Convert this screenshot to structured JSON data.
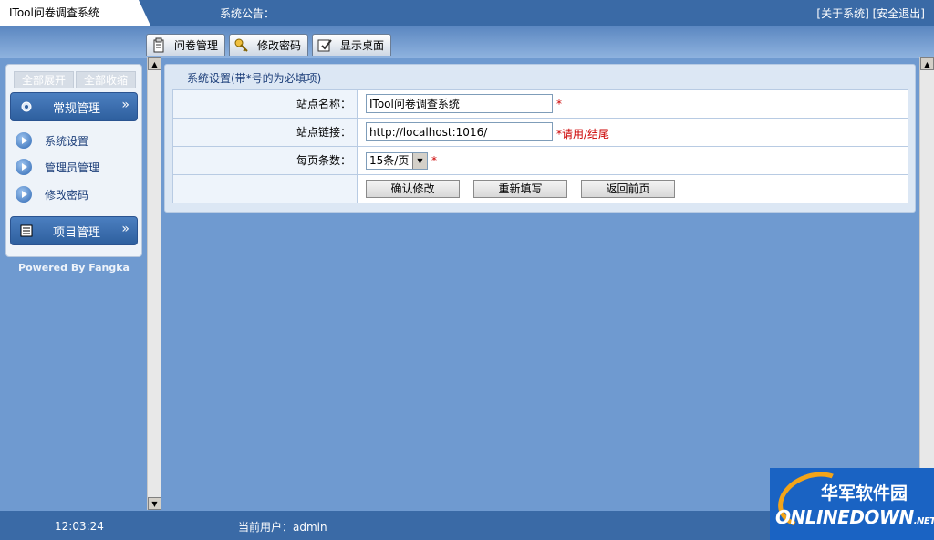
{
  "header": {
    "app_title": "ITool问卷调查系统",
    "notice_label": "系统公告：",
    "about_link": "[关于系统]",
    "logout_link": "[安全退出]"
  },
  "tabs": [
    {
      "label": "问卷管理",
      "icon": "clipboard-icon"
    },
    {
      "label": "修改密码",
      "icon": "key-icon"
    },
    {
      "label": "显示桌面",
      "icon": "desktop-icon"
    }
  ],
  "sidebar": {
    "expand_all": "全部展开",
    "collapse_all": "全部收缩",
    "groups": [
      {
        "label": "常规管理",
        "icon": "gear-icon",
        "items": [
          {
            "label": "系统设置"
          },
          {
            "label": "管理员管理"
          },
          {
            "label": "修改密码"
          }
        ]
      },
      {
        "label": "项目管理",
        "icon": "list-icon",
        "items": []
      }
    ],
    "powered_by": "Powered By Fangka"
  },
  "form": {
    "title": "系统设置(带*号的为必填项)",
    "fields": [
      {
        "label": "站点名称：",
        "value": "ITool问卷调查系统",
        "required_mark": "*"
      },
      {
        "label": "站点链接：",
        "value": "http://localhost:1016/",
        "required_mark": "*请用/结尾"
      },
      {
        "label": "每页条数：",
        "value": "15条/页",
        "required_mark": "*"
      }
    ],
    "buttons": {
      "confirm": "确认修改",
      "reset": "重新填写",
      "back": "返回前页"
    }
  },
  "footer": {
    "clock": "12:03:24",
    "current_user": "当前用户：admin"
  },
  "watermark": {
    "cn": "华军软件园",
    "en": "ONLINEDOWN",
    "en_suffix": ".NET"
  },
  "colors": {
    "accent": "#3a6aa6",
    "background": "#6f9ad0",
    "required": "#cc0000"
  }
}
